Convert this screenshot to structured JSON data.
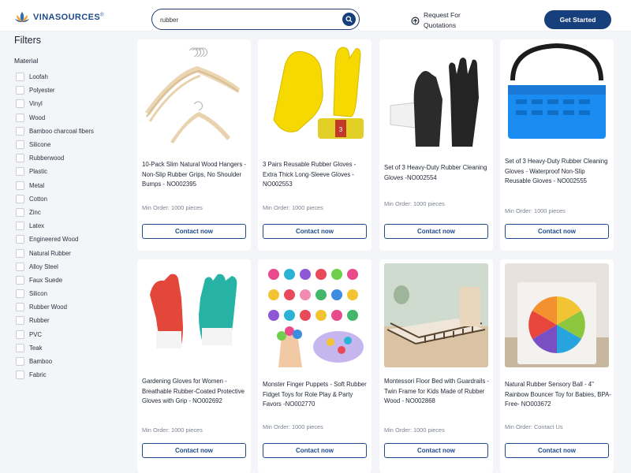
{
  "header": {
    "brand": "VINASOURCES",
    "brand_mark": "®",
    "search_value": "rubber",
    "rfq_line1": "Request For",
    "rfq_line2": "Quotations",
    "cta_label": "Get Started"
  },
  "sidebar": {
    "title": "Filters",
    "material_heading": "Material",
    "materials": [
      "Loofah",
      "Polyester",
      "Vinyl",
      "Wood",
      "Bamboo charcoal fibers",
      "Silicone",
      "Rubberwood",
      "Plastic",
      "Metal",
      "Cotton",
      "Zinc",
      "Latex",
      "Engineered Wood",
      "Natural Rubber",
      "Alloy Steel",
      "Faux Suede",
      "Silicon",
      "Rubber Wood",
      "Rubber",
      "PVC",
      "Teak",
      "Bamboo",
      "Fabric"
    ]
  },
  "products": [
    {
      "title": "10-Pack Slim Natural Wood Hangers - Non-Slip Rubber Grips, No Shoulder Bumps - NO002395",
      "moq": "Min Order: 1000 pieces",
      "button": "Contact now",
      "image": "wooden-hangers"
    },
    {
      "title": "3 Pairs Reusable Rubber Gloves - Extra Thick Long-Sleeve Gloves - NO002553",
      "moq": "Min Order: 1000 pieces",
      "button": "Contact now",
      "image": "yellow-rubber-gloves"
    },
    {
      "title": "Set of 3 Heavy-Duty Rubber Cleaning Gloves -NO002554",
      "moq": "Min Order: 1000 pieces",
      "button": "Contact now",
      "image": "black-rubber-gloves"
    },
    {
      "title": "Set of 3 Heavy-Duty Rubber Cleaning Gloves - Waterproof Non-Slip Reusable Gloves - NO002555",
      "moq": "Min Order: 1000 pieces",
      "button": "Contact now",
      "image": "blue-basket"
    },
    {
      "title": "Gardening Gloves for Women - Breathable Rubber-Coated Protective Gloves with Grip - NO002692",
      "moq": "Min Order: 1000 pieces",
      "button": "Contact now",
      "image": "gardening-gloves"
    },
    {
      "title": "Monster Finger Puppets - Soft Rubber Fidget Toys for Role Play & Party Favors -NO002770",
      "moq": "Min Order: 1000 pieces",
      "button": "Contact now",
      "image": "finger-puppets"
    },
    {
      "title": "Montessori Floor Bed with Guardrails - Twin Frame for Kids Made of Rubber Wood - NO002868",
      "moq": "Min Order: 1000 pieces",
      "button": "Contact now",
      "image": "floor-bed"
    },
    {
      "title": "Natural Rubber Sensory Ball - 4\" Rainbow Bouncer Toy for Babies, BPA-Free- NO003672",
      "moq": "Min Order: Contact Us",
      "button": "Contact now",
      "image": "rainbow-ball"
    }
  ],
  "colors": {
    "brand_navy": "#173f7c",
    "button_border": "#1f4a8c",
    "page_bg": "#f4f5f8"
  }
}
